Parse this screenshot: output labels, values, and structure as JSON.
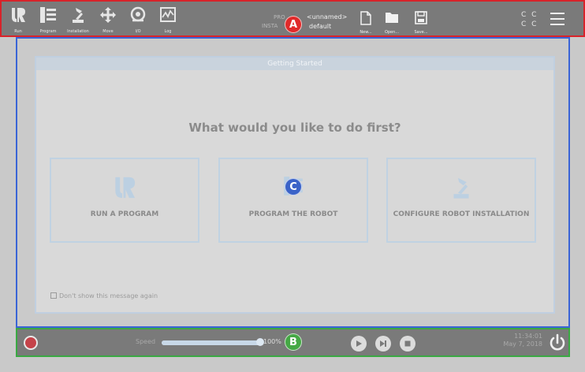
{
  "header": {
    "tools": [
      {
        "name": "run",
        "label": "Run",
        "icon": "ur-logo-icon"
      },
      {
        "name": "program",
        "label": "Program",
        "icon": "program-icon"
      },
      {
        "name": "installation",
        "label": "Installation",
        "icon": "robot-arm-icon"
      },
      {
        "name": "move",
        "label": "Move",
        "icon": "move-arrows-icon"
      },
      {
        "name": "io",
        "label": "I/O",
        "icon": "io-icon"
      },
      {
        "name": "log",
        "label": "Log",
        "icon": "log-icon"
      }
    ],
    "program_label": "PRO",
    "installation_label": "INSTA",
    "program_value": "<unnamed>",
    "installation_value": "default",
    "file_tools": [
      {
        "name": "new",
        "label": "New...",
        "icon": "new-file-icon"
      },
      {
        "name": "open",
        "label": "Open...",
        "icon": "folder-icon"
      },
      {
        "name": "save",
        "label": "Save...",
        "icon": "save-icon"
      }
    ],
    "cc_top": "C C",
    "cc_bottom": "C C",
    "marker": "A"
  },
  "dialog": {
    "title": "Getting Started",
    "question": "What would you like to do first?",
    "choices": [
      {
        "name": "run-a-program",
        "label": "RUN A PROGRAM",
        "icon": "ur-logo-icon"
      },
      {
        "name": "program-the-robot",
        "label": "PROGRAM THE ROBOT",
        "icon": "program-icon"
      },
      {
        "name": "configure-robot-installation",
        "label": "CONFIGURE ROBOT INSTALLATION",
        "icon": "robot-arm-icon"
      }
    ],
    "dont_show": "Don't show this message again",
    "marker": "C"
  },
  "footer": {
    "speed_label": "Speed",
    "speed_value": "100%",
    "speed_fraction": 1.0,
    "time": "11:34:01",
    "date": "May 7, 2018",
    "marker": "B"
  },
  "colors": {
    "header_border": "#d8232a",
    "main_border": "#3a64d6",
    "footer_border": "#3aa843",
    "marker_a": "#e02a2a",
    "marker_b": "#45a845",
    "marker_c": "#3b63c8"
  }
}
